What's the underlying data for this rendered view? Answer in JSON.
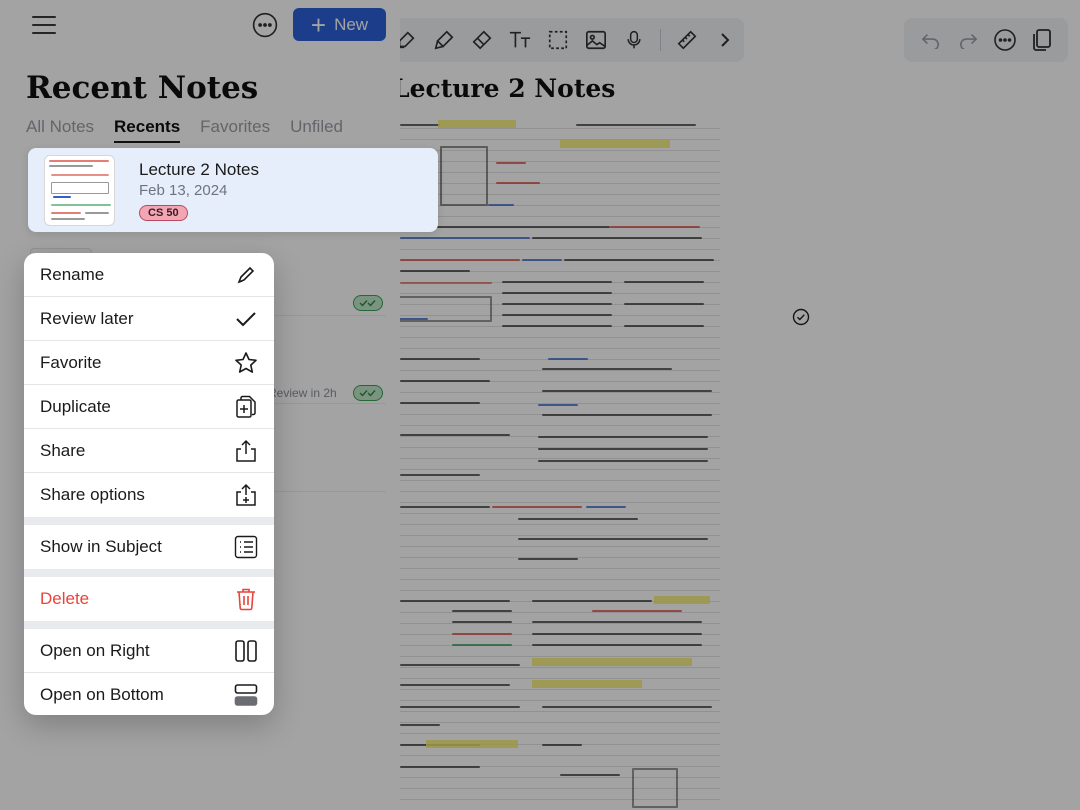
{
  "toolbar": {
    "tools": [
      "highlighter-icon",
      "marker-icon",
      "eraser-icon",
      "text-icon",
      "lasso-select-icon",
      "image-icon",
      "microphone-icon",
      "ruler-icon",
      "chevron-right-icon"
    ],
    "actions": [
      "undo-icon",
      "redo-icon",
      "more-icon",
      "pages-icon"
    ]
  },
  "editor": {
    "title": "Lecture 2 Notes"
  },
  "panel": {
    "title": "Recent Notes",
    "new_button": "New",
    "tabs": [
      "All Notes",
      "Recents",
      "Favorites",
      "Unfiled"
    ],
    "active_tab": "Recents",
    "review_text": "Review in 2h"
  },
  "selected_note": {
    "name": "Lecture 2 Notes",
    "date": "Feb 13, 2024",
    "subject": "CS 50",
    "subject_color": "#f2a6b3"
  },
  "menu": {
    "items": [
      {
        "label": "Rename",
        "icon": "pencil-icon"
      },
      {
        "label": "Review later",
        "icon": "checkmark-icon"
      },
      {
        "label": "Favorite",
        "icon": "star-icon"
      },
      {
        "label": "Duplicate",
        "icon": "duplicate-icon"
      },
      {
        "label": "Share",
        "icon": "share-icon"
      },
      {
        "label": "Share options",
        "icon": "share-options-icon"
      },
      {
        "label": "Show in Subject",
        "icon": "list-icon"
      },
      {
        "label": "Delete",
        "icon": "trash-icon"
      },
      {
        "label": "Open on Right",
        "icon": "split-right-icon"
      },
      {
        "label": "Open on Bottom",
        "icon": "split-bottom-icon"
      }
    ]
  },
  "colors": {
    "accent": "#2d62d8",
    "danger": "#e8443a",
    "selected_bg": "#e6edfb",
    "status_green": "#39a35a"
  }
}
